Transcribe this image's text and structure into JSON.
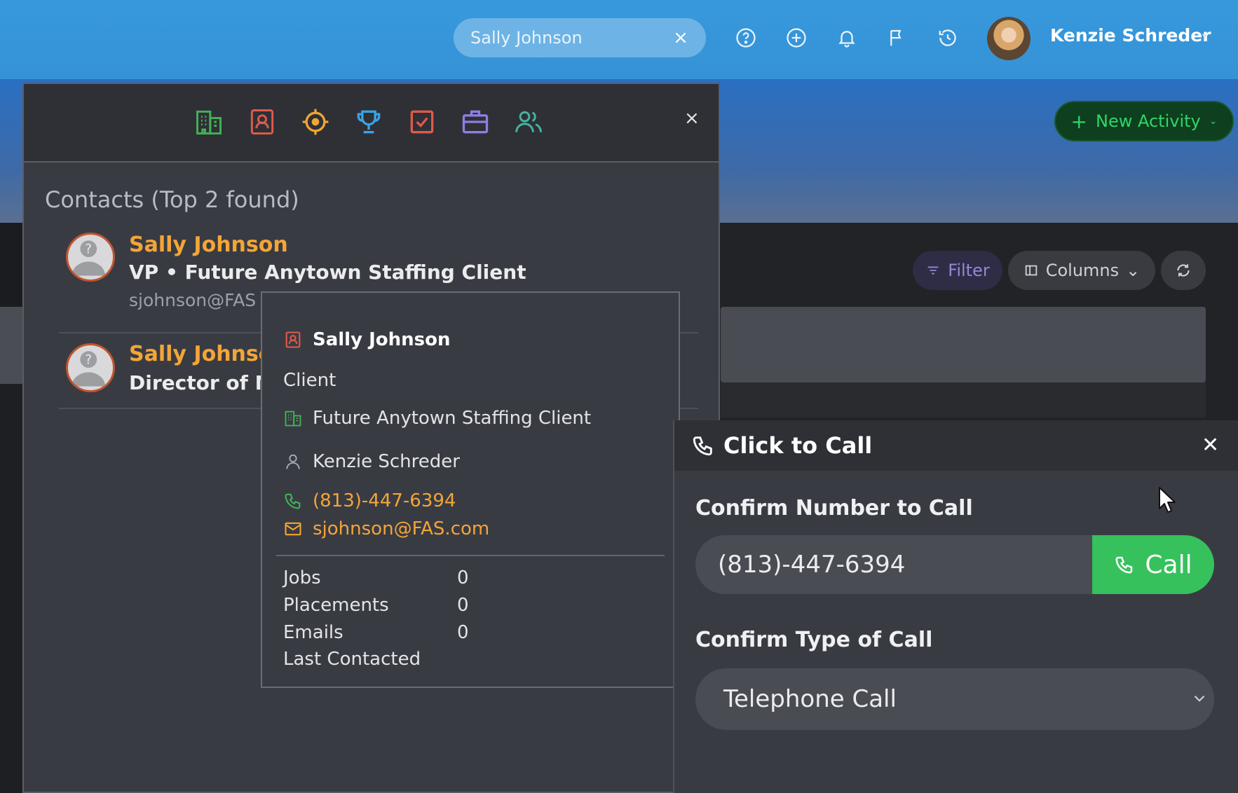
{
  "topbar": {
    "search_value": "Sally Johnson",
    "clear_symbol": "×",
    "icons": [
      "help-icon",
      "add-circle-icon",
      "bell-icon",
      "flag-icon",
      "history-icon"
    ],
    "user_name": "Kenzie Schreder",
    "user_caret": "▾"
  },
  "header_actions": {
    "new_activity_plus": "+",
    "new_activity_label": "New Activity",
    "new_activity_caret": "⌄"
  },
  "grid_toolbar": {
    "filter_label": "Filter",
    "columns_label": "Columns",
    "columns_caret": "⌄"
  },
  "results": {
    "category_icons": [
      "companies-icon",
      "contacts-icon",
      "leads-icon",
      "opportunities-icon",
      "tasks-icon",
      "jobs-icon",
      "candidates-icon"
    ],
    "close_symbol": "×",
    "title": "Contacts (Top 2 found)",
    "contacts": [
      {
        "name": "Sally Johnson",
        "subtitle": "VP • Future Anytown Staffing Client",
        "email": "sjohnson@FAS"
      },
      {
        "name": "Sally Johnso",
        "subtitle": "Director of Mc"
      }
    ]
  },
  "hover_card": {
    "name": "Sally Johnson",
    "type": "Client",
    "company": "Future Anytown Staffing Client",
    "owner": "Kenzie Schreder",
    "phone": "(813)-447-6394",
    "email": "sjohnson@FAS.com",
    "stats": [
      {
        "label": "Jobs",
        "value": "0"
      },
      {
        "label": "Placements",
        "value": "0"
      },
      {
        "label": "Emails",
        "value": "0"
      },
      {
        "label": "Last Contacted",
        "value": ""
      }
    ]
  },
  "call_panel": {
    "title": "Click to Call",
    "close_symbol": "✕",
    "number_label": "Confirm Number to Call",
    "number_value": "(813)-447-6394",
    "call_button_label": "Call",
    "type_label": "Confirm Type of Call",
    "type_value": "Telephone Call"
  },
  "colors": {
    "topbar": "#3799dc",
    "accent_orange": "#f3a537",
    "call_green": "#36c15c",
    "new_activity_green": "#2fd66b"
  }
}
